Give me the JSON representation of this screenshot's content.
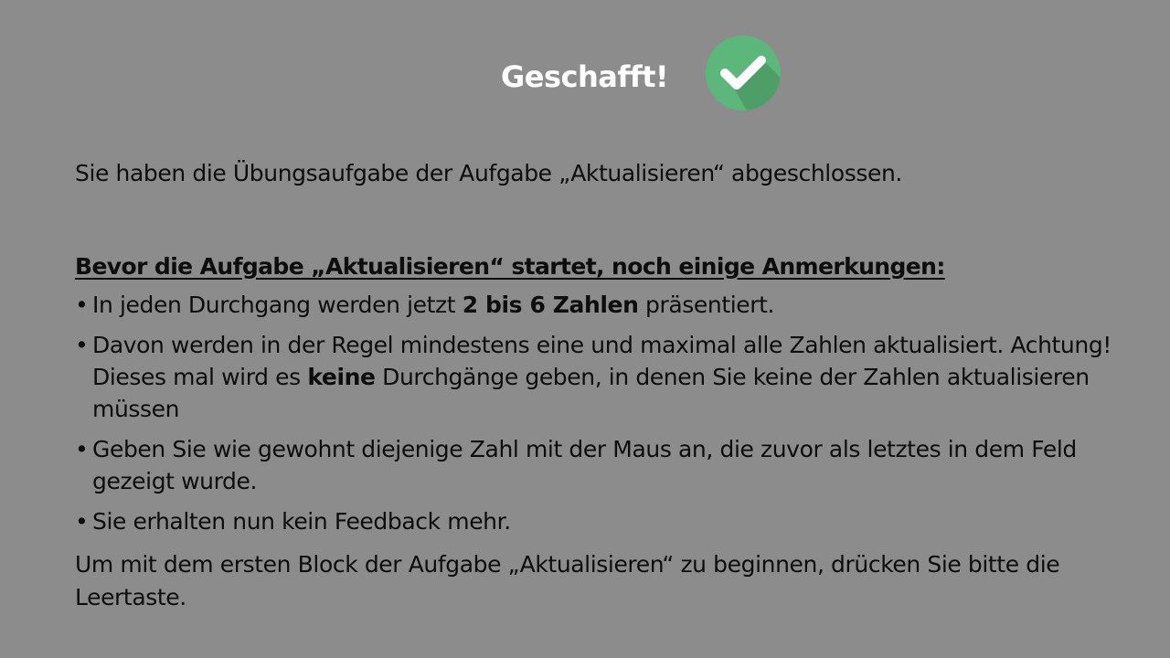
{
  "title": "Geschafft!",
  "icon": "checkmark-circle-icon",
  "colors": {
    "background": "#8c8c8c",
    "check_circle": "#5cb87a",
    "check_shadow": "#4e9e68",
    "title": "#ffffff",
    "text": "#0d0d0d"
  },
  "intro": "Sie haben die Übungsaufgabe der Aufgabe „Aktualisieren“ abgeschlossen.",
  "heading": "Bevor die Aufgabe „Aktualisieren“ startet, noch einige Anmerkungen:",
  "bullets": [
    {
      "before": "In jeden Durchgang werden jetzt ",
      "bold": "2 bis 6 Zahlen",
      "after": " präsentiert."
    },
    {
      "before": "Davon werden in der Regel mindestens eine und maximal alle Zahlen aktualisiert. Achtung! Dieses mal wird es ",
      "bold": "keine",
      "after": " Durchgänge geben, in denen Sie keine der Zahlen aktualisieren müssen"
    },
    {
      "text": "Geben Sie wie gewohnt diejenige Zahl mit der Maus an, die zuvor als letztes in dem Feld gezeigt wurde."
    },
    {
      "text": "Sie erhalten nun kein Feedback mehr."
    }
  ],
  "bullet_char": "•",
  "outro": "Um mit dem ersten Block der Aufgabe „Aktualisieren“ zu beginnen, drücken Sie bitte die Leertaste."
}
